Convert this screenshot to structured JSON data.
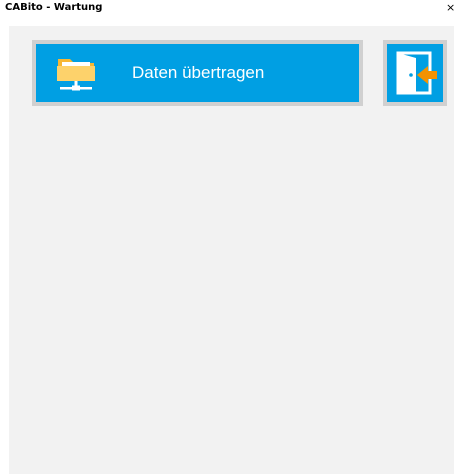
{
  "window": {
    "title": "CABito - Wartung",
    "close_glyph": "×"
  },
  "actions": {
    "transfer": {
      "label": "Daten übertragen",
      "icon": "network-folder-icon"
    },
    "exit": {
      "icon": "exit-door-icon"
    }
  },
  "colors": {
    "tile_blue": "#009fe3",
    "tile_frame": "#d0d0d0",
    "background": "#f2f2f2",
    "folder_yellow": "#fdd26b",
    "arrow_orange": "#f39200"
  }
}
